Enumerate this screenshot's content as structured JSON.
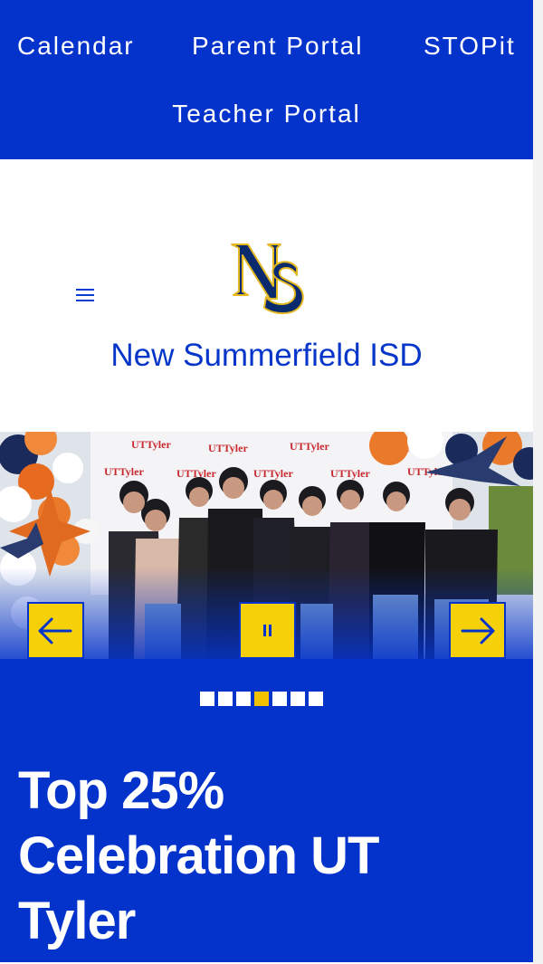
{
  "utility_nav": {
    "items": [
      {
        "label": "Calendar"
      },
      {
        "label": "Parent Portal"
      },
      {
        "label": "STOPit"
      },
      {
        "label": "Teacher Portal"
      }
    ]
  },
  "header": {
    "logo_text": "NS",
    "school_name": "New Summerfield ISD",
    "menu_icon": "hamburger-icon"
  },
  "slideshow": {
    "controls": {
      "prev_icon": "arrow-left-icon",
      "pause_icon": "pause-icon",
      "next_icon": "arrow-right-icon"
    },
    "dot_count": 7,
    "active_index": 3,
    "slide_title": "Top 25% Celebration UT Tyler",
    "backdrop_text": "UTTyler"
  },
  "colors": {
    "brand_blue": "#0433cc",
    "accent_yellow": "#f6d10a",
    "active_dot": "#f2c200"
  }
}
